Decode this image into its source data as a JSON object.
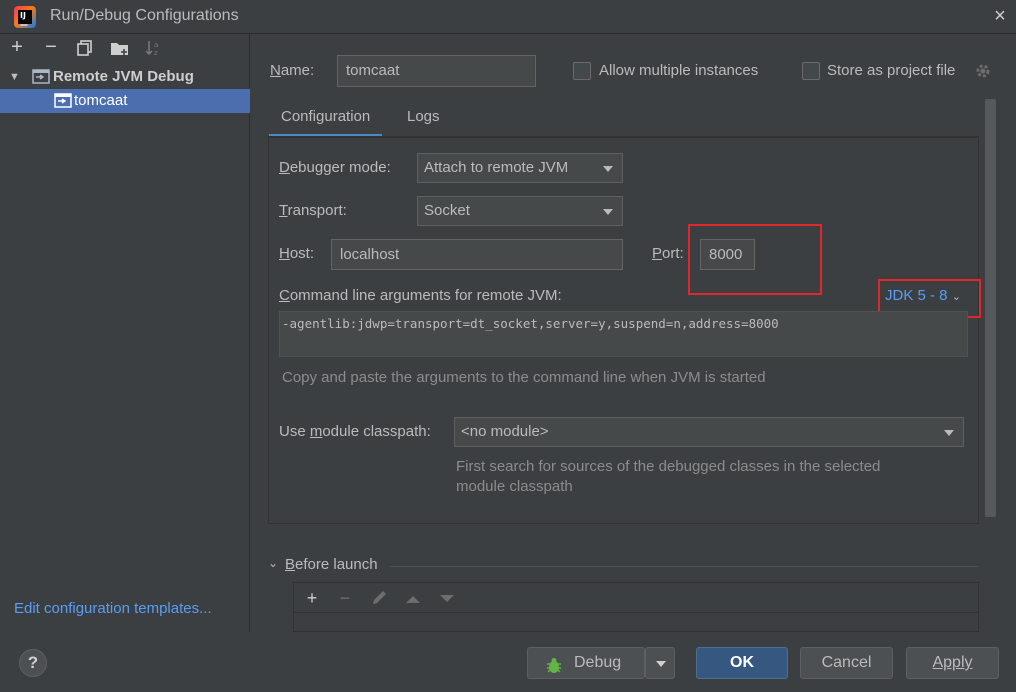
{
  "window": {
    "title": "Run/Debug Configurations",
    "close_glyph": "×"
  },
  "left_toolbar": {
    "add_glyph": "+",
    "remove_glyph": "−"
  },
  "tree": {
    "group": {
      "label": "Remote JVM Debug",
      "expanded": true
    },
    "items": [
      {
        "label": "tomcaat",
        "selected": true
      }
    ]
  },
  "edit_templates_link": "Edit configuration templates...",
  "name_field": {
    "label": "Name:",
    "value": "tomcaat"
  },
  "allow_multiple": {
    "label": "Allow multiple instances",
    "checked": false
  },
  "store_project": {
    "label": "Store as project file",
    "checked": false
  },
  "tabs": [
    {
      "label": "Configuration",
      "active": true
    },
    {
      "label": "Logs",
      "active": false
    }
  ],
  "debugger_mode": {
    "label": "Debugger mode:",
    "value": "Attach to remote JVM"
  },
  "transport": {
    "label": "Transport:",
    "value": "Socket"
  },
  "host": {
    "label": "Host:",
    "value": "localhost"
  },
  "port": {
    "label": "Port:",
    "value": "8000"
  },
  "cmd_args": {
    "label": "Command line arguments for remote JVM:",
    "jdk_selector": "JDK 5 - 8",
    "value": "-agentlib:jdwp=transport=dt_socket,server=y,suspend=n,address=8000",
    "hint": "Copy and paste the arguments to the command line when JVM is started"
  },
  "module_classpath": {
    "label": "Use module classpath:",
    "value": "<no module>",
    "hint_line1": "First search for sources of the debugged classes in the selected",
    "hint_line2": "module classpath"
  },
  "before_launch": {
    "label": "Before launch",
    "add_glyph": "+",
    "remove_glyph": "−"
  },
  "buttons": {
    "help": "?",
    "debug": "Debug",
    "ok": "OK",
    "cancel": "Cancel",
    "apply": "Apply"
  },
  "colors": {
    "accent": "#4a88c7",
    "selection": "#4b6eaf",
    "link": "#589df6",
    "highlight_box": "#e0282b",
    "primary_button": "#365880"
  }
}
